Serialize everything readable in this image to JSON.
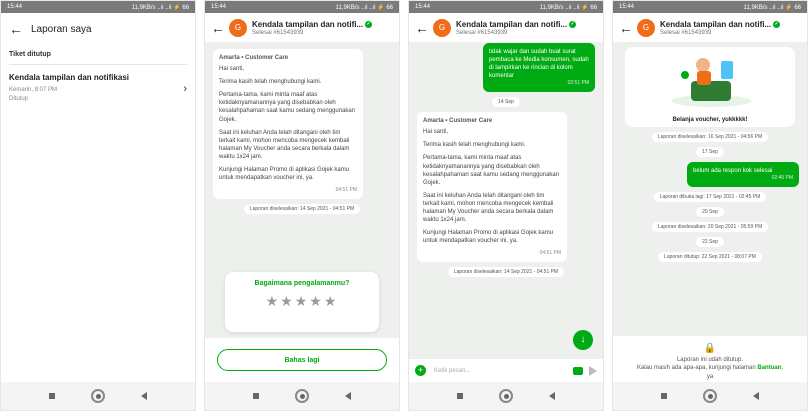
{
  "status_bar": {
    "time": "15:44",
    "signal": "11,9KB/s ..ıl ..ıl ⚡ 66"
  },
  "panel1": {
    "title": "Laporan saya",
    "section": "Tiket ditutup",
    "ticket": {
      "title": "Kendala tampilan dan notifikasi",
      "date": "Kemarin, 8:07 PM",
      "status": "Ditutup"
    }
  },
  "chat": {
    "title": "Kendala tampilan dan notifi...",
    "ticket_id": "Selesai #61543939",
    "avatar_letter": "G"
  },
  "message": {
    "sender": "Amarta • Customer Care",
    "lines": [
      "Hai santi,",
      "Terima kasih telah menghubungi kami.",
      "Pertama-tama, kami minta maaf atas ketidaknyamanannya yang disebabkan oleh kesalahpahaman saat kamu sedang menggunakan Gojek.",
      "Saat ini keluhan Anda telah ditangani oleh tim terkait kami, mohon mencoba mengecek kembali halaman My Voucher anda secara berkala dalam waktu 1x24 jam.",
      "Kunjungi Halaman Promo di aplikasi Gojek kamu untuk mendapatkan voucher ini, ya."
    ],
    "time": "04:51 PM"
  },
  "panel2": {
    "resolved": "Laporan diselesaikan: 14 Sep 2021 - 04:51 PM",
    "rating_question": "Bagaimana pengalamanmu?",
    "stars": "★★★★★",
    "button": "Bahas lagi"
  },
  "panel3": {
    "out_bubble": "tidak wajar dan sudah buat surat pembaca ke Media konsumen, sudah di lampirkan ke rincian di kolom komentar",
    "out_time": "02:51 PM",
    "date_pill": "14 Sep",
    "resolved": "Laporan diselesaikan: 14 Sep 2021 - 04:51 PM",
    "composer_placeholder": "Ketik pesan...",
    "fab_icon": "↓"
  },
  "panel4": {
    "voucher_caption": "Belanja voucher, yukkkkk!",
    "pill1": "Laporan diselesaikan: 16 Sep 2021 - 04:56 PM",
    "date1": "17 Sep",
    "out_bubble": "belum ada respon kok selesai",
    "out_time": "02:45 PM",
    "pill2": "Laporan dibuka lagi: 17 Sep 2021 - 02:45 PM",
    "date2": "20 Sep",
    "pill3": "Laporan diselesaikan: 20 Sep 2021 - 05:59 PM",
    "date3": "22 Sep",
    "pill4": "Laporan ditutup: 22 Sep 2021 - 08:07 PM",
    "closed_line1": "Laporan ini udah ditutup.",
    "closed_line2": "Kalau masih ada apa-apa, kunjungi halaman",
    "closed_link": "Bantuan",
    "closed_line3": "ya"
  },
  "colors": {
    "accent": "#00aa13",
    "avatar": "#ef6c1a"
  }
}
